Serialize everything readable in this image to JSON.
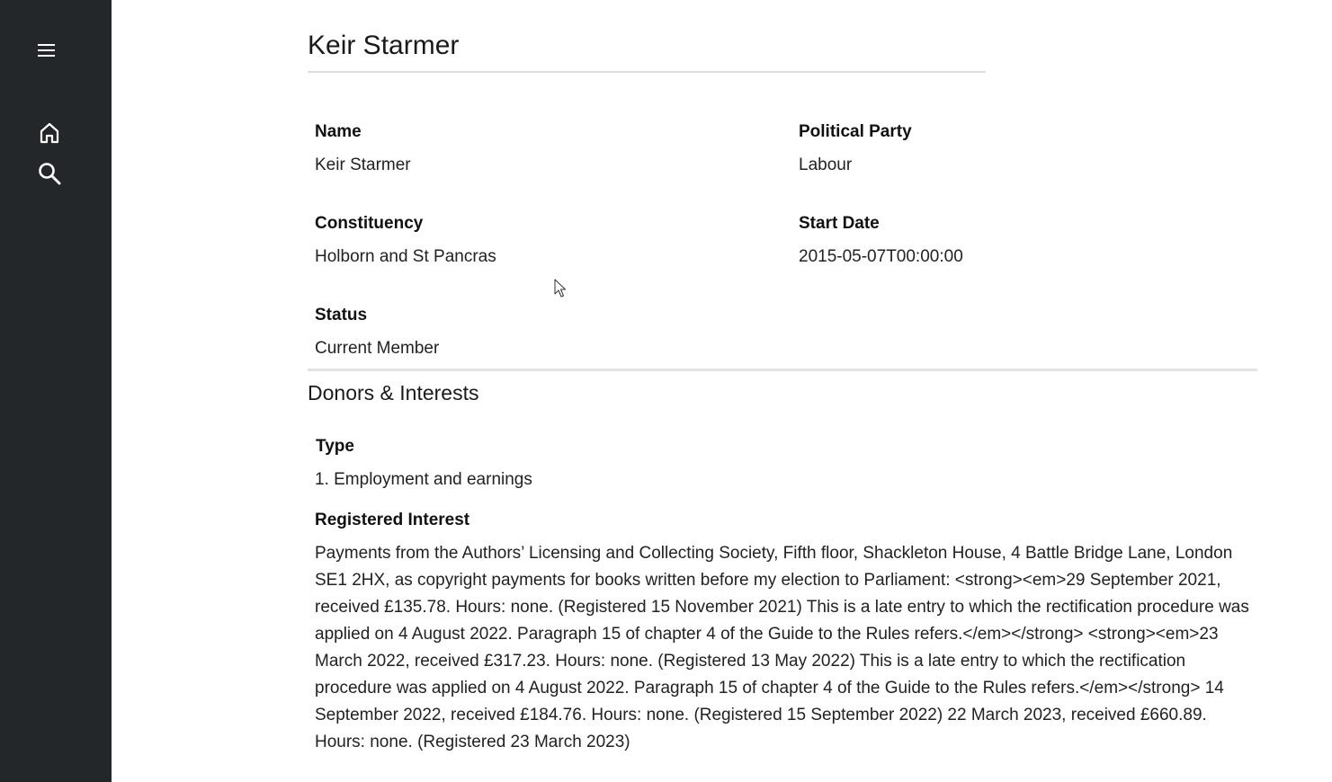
{
  "sidebar": {
    "menu_icon": "hamburger-menu-icon",
    "items": [
      {
        "icon": "home-icon"
      },
      {
        "icon": "search-icon"
      }
    ],
    "background_color": "#242729"
  },
  "member": {
    "title": "Keir Starmer",
    "fields": {
      "name_label": "Name",
      "name_value": "Keir Starmer",
      "party_label": "Political Party",
      "party_value": "Labour",
      "constituency_label": "Constituency",
      "constituency_value": "Holborn and St Pancras",
      "start_date_label": "Start Date",
      "start_date_value": "2015-05-07T00:00:00",
      "status_label": "Status",
      "status_value": "Current Member"
    }
  },
  "interests": {
    "section_title": "Donors & Interests",
    "type_label": "Type",
    "type_value": "1. Employment and earnings",
    "registered_label": "Registered Interest",
    "registered_value": "Payments from the Authors’ Licensing and Collecting Society, Fifth floor, Shackleton House, 4 Battle Bridge Lane, London SE1 2HX, as copyright payments for books written before my election to Parliament: <strong><em>29 September 2021, received £135.78. Hours: none. (Registered 15 November 2021) This is a late entry to which the rectification procedure was applied on 4 August 2022. Paragraph 15 of chapter 4 of the Guide to the Rules refers.</em></strong> <strong><em>23 March 2022, received £317.23. Hours: none. (Registered 13 May 2022) This is a late entry to which the rectification procedure was applied on 4 August 2022. Paragraph 15 of chapter 4 of the Guide to the Rules refers.</em></strong> 14 September 2022, received £184.76. Hours: none. (Registered 15 September 2022) 22 March 2023, received £660.89. Hours: none. (Registered 23 March 2023)"
  }
}
